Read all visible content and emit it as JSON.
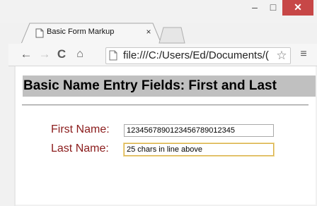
{
  "window": {
    "controls": {
      "minimize": "–",
      "maximize": "□",
      "close": "✕"
    }
  },
  "tab": {
    "title": "Basic Form Markup",
    "close": "×",
    "favicon": "page-icon"
  },
  "toolbar": {
    "back": "←",
    "forward": "→",
    "reload": "C",
    "home": "⌂",
    "url": "file:///C:/Users/Ed/Documents/(",
    "star": "☆",
    "menu": "≡"
  },
  "page": {
    "heading": "Basic Name Entry Fields: First and Last",
    "fields": [
      {
        "label": "First Name:",
        "value": "1234567890123456789012345"
      },
      {
        "label": "Last Name:",
        "value": "25 chars in line above"
      }
    ]
  },
  "colors": {
    "label": "#8b1c1c",
    "heading_bg": "#c0c0c0",
    "close_button": "#c74747"
  }
}
